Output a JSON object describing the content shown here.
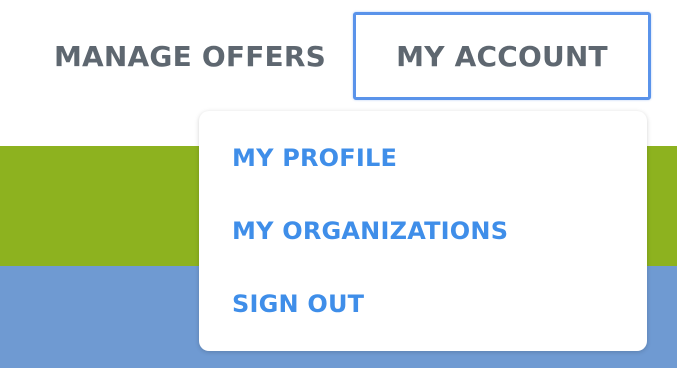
{
  "nav": {
    "manage_offers": "MANAGE OFFERS",
    "my_account": "MY ACCOUNT"
  },
  "dropdown": {
    "items": [
      {
        "label": "MY PROFILE"
      },
      {
        "label": "MY ORGANIZATIONS"
      },
      {
        "label": "SIGN OUT"
      }
    ]
  },
  "colors": {
    "nav_text": "#5e6770",
    "menu_text": "#3f8ee9",
    "focus_border": "#5a93ea",
    "green_band": "#8db21f",
    "blue_band": "#6f9ad2"
  }
}
